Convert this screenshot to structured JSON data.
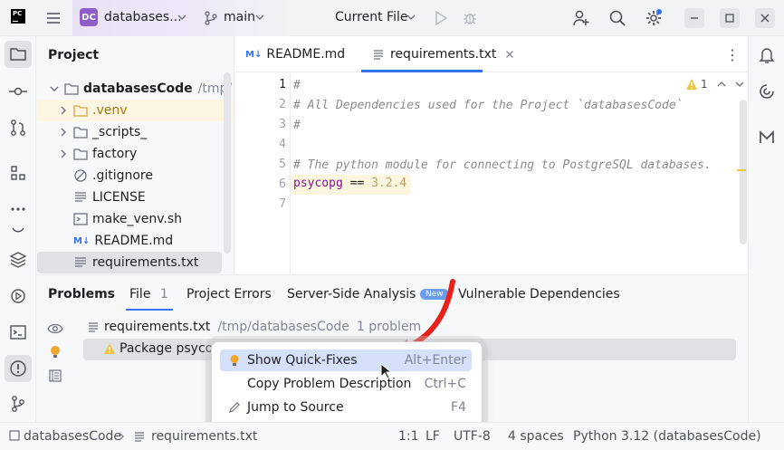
{
  "titlebar": {
    "app_logo": "PC",
    "project_badge": "DC",
    "project_name": "databases...",
    "branch": "main",
    "run_config": "Current File",
    "icons": [
      "hamburger-icon",
      "chevron-down-icon",
      "branch-icon",
      "run-icon",
      "debug-icon",
      "add-user-icon",
      "search-icon",
      "gear-icon",
      "minimize-icon",
      "maximize-icon",
      "close-icon"
    ]
  },
  "project_panel": {
    "title": "Project",
    "root": {
      "name": "databasesCode",
      "path": "/tmp/databa"
    },
    "items": [
      {
        "label": ".venv",
        "kind": "folder",
        "expandable": true
      },
      {
        "label": "_scripts_",
        "kind": "folder",
        "expandable": true
      },
      {
        "label": "factory",
        "kind": "folder",
        "expandable": true
      },
      {
        "label": ".gitignore",
        "kind": "file"
      },
      {
        "label": "LICENSE",
        "kind": "file"
      },
      {
        "label": "make_venv.sh",
        "kind": "file"
      },
      {
        "label": "README.md",
        "kind": "markdown"
      },
      {
        "label": "requirements.txt",
        "kind": "text"
      }
    ]
  },
  "editor": {
    "tabs": [
      {
        "label": "README.md",
        "icon": "markdown-icon"
      },
      {
        "label": "requirements.txt",
        "icon": "text-file-icon",
        "active": true
      }
    ],
    "tab_menu_glyph": "⋮",
    "inspection": {
      "warnings": "1"
    },
    "line_numbers": [
      "1",
      "2",
      "3",
      "4",
      "5",
      "6",
      "7"
    ],
    "lines": [
      "#",
      "# All Dependencies used for the Project `databasesCode`",
      "#",
      "",
      "# The python module for connecting to PostgreSQL databases.",
      "",
      ""
    ],
    "package_line": {
      "name": "psycopg",
      "op": "==",
      "version": "3.2.4"
    }
  },
  "problems_panel": {
    "tabs": [
      {
        "label": "Problems"
      },
      {
        "label": "File",
        "count": "1"
      },
      {
        "label": "Project Errors"
      },
      {
        "label": "Server-Side Analysis",
        "badge": "New"
      },
      {
        "label": "Vulnerable Dependencies"
      }
    ],
    "file_row": {
      "name": "requirements.txt",
      "path": "/tmp/databasesCode",
      "summary": "1 problem"
    },
    "problem_row": {
      "text": "Package psycopg"
    }
  },
  "context_menu": {
    "items": [
      {
        "label": "Show Quick-Fixes",
        "shortcut": "Alt+Enter",
        "icon": "bulb-icon"
      },
      {
        "label": "Copy Problem Description",
        "shortcut": "Ctrl+C",
        "icon": ""
      },
      {
        "label": "Jump to Source",
        "shortcut": "F4",
        "icon": "pencil-icon"
      }
    ]
  },
  "statusbar": {
    "breadcrumb_project": "databasesCode",
    "breadcrumb_file": "requirements.txt",
    "position": "1:1",
    "line_ending": "LF",
    "encoding": "UTF-8",
    "indent": "4 spaces",
    "interpreter": "Python 3.12 (databasesCode)"
  },
  "colors": {
    "accent": "#3574f0",
    "selection": "#dfe1e5",
    "warning": "#f0c341",
    "annotation_arrow": "#e8221b",
    "project_badge": "#8e5dc7"
  }
}
